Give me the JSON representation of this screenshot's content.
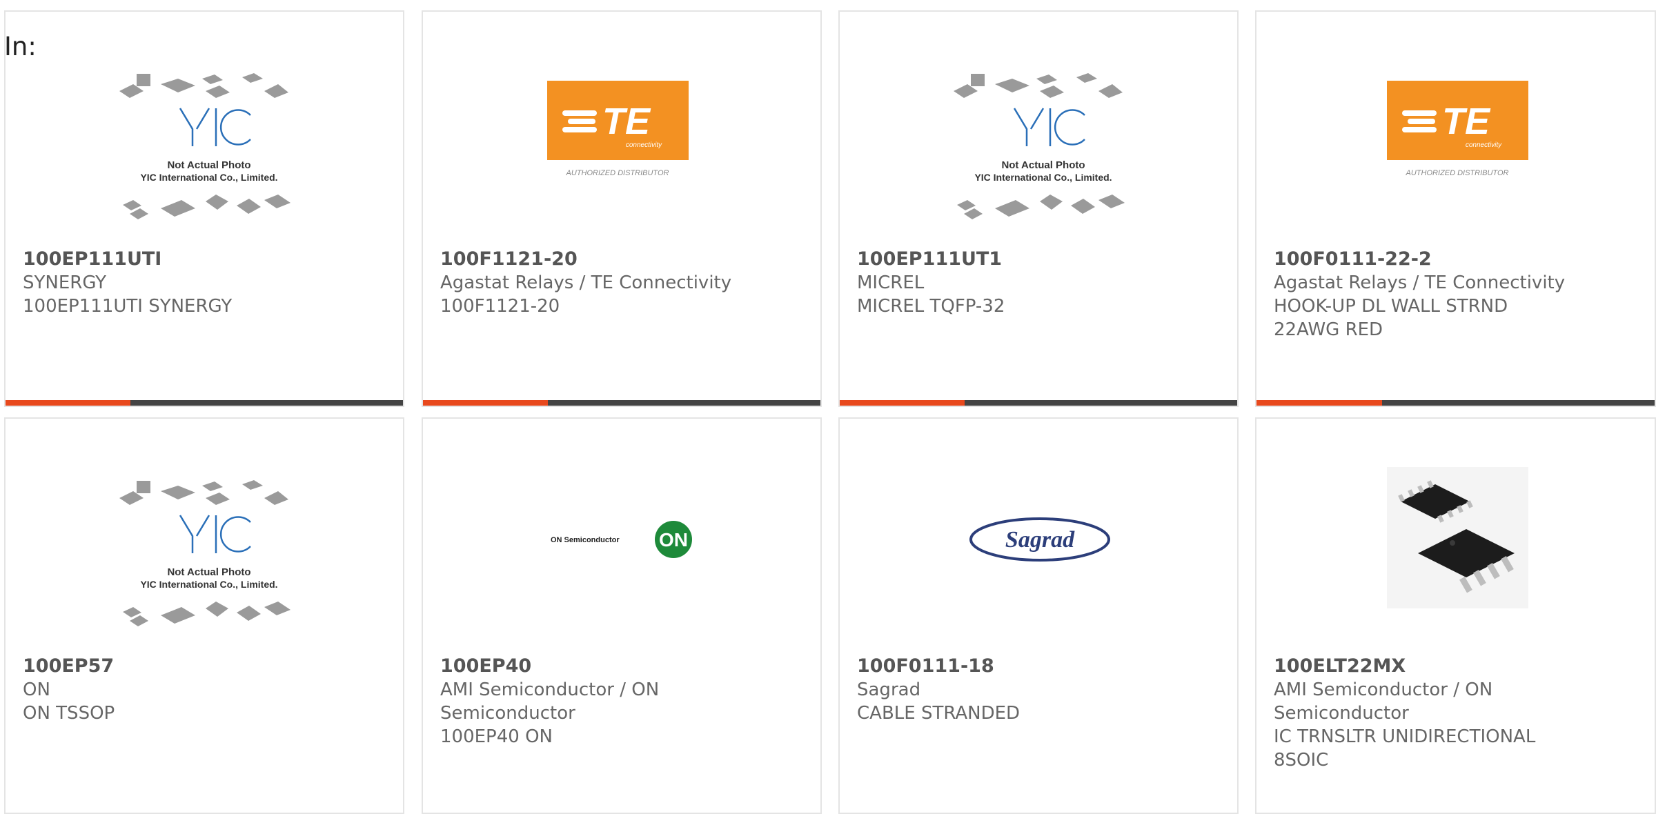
{
  "page": {
    "in_label": "In:"
  },
  "colors": {
    "accent": "#e8491d",
    "bar": "#444444",
    "te_orange": "#f39122",
    "yic_blue": "#2a6fb8",
    "on_green": "#1e8a3a"
  },
  "products": [
    {
      "part": "100EP111UTI",
      "manufacturer": "SYNERGY",
      "desc1": "100EP111UTI SYNERGY",
      "desc2": "",
      "image": "yic-placeholder",
      "image_caption1": "Not Actual Photo",
      "image_caption2": "YIC International Co., Limited.",
      "logo_text": "YIC"
    },
    {
      "part": "100F1121-20",
      "manufacturer": "Agastat Relays / TE Connectivity",
      "desc1": "100F1121-20",
      "desc2": "",
      "image": "te-logo",
      "logo_text": "TE",
      "logo_sub": "connectivity",
      "image_caption1": "AUTHORIZED DISTRIBUTOR"
    },
    {
      "part": "100EP111UT1",
      "manufacturer": "MICREL",
      "desc1": "MICREL TQFP-32",
      "desc2": "",
      "image": "yic-placeholder",
      "image_caption1": "Not Actual Photo",
      "image_caption2": "YIC International Co., Limited.",
      "logo_text": "YIC"
    },
    {
      "part": "100F0111-22-2",
      "manufacturer": "Agastat Relays / TE Connectivity",
      "desc1": "HOOK-UP DL WALL STRND",
      "desc2": "22AWG RED",
      "image": "te-logo",
      "logo_text": "TE",
      "logo_sub": "connectivity",
      "image_caption1": "AUTHORIZED DISTRIBUTOR"
    },
    {
      "part": "100EP57",
      "manufacturer": "ON",
      "desc1": "ON TSSOP",
      "desc2": "",
      "image": "yic-placeholder",
      "image_caption1": "Not Actual Photo",
      "image_caption2": "YIC International Co., Limited.",
      "logo_text": "YIC"
    },
    {
      "part": "100EP40",
      "manufacturer_line1": "AMI Semiconductor / ON",
      "manufacturer_line2": "Semiconductor",
      "desc1": "100EP40 ON",
      "image": "on-logo",
      "logo_text": "ON Semiconductor",
      "logo_badge": "ON"
    },
    {
      "part": "100F0111-18",
      "manufacturer": "Sagrad",
      "desc1": "CABLE STRANDED",
      "desc2": "",
      "image": "sagrad-logo",
      "logo_text": "Sagrad"
    },
    {
      "part": "100ELT22MX",
      "manufacturer_line1": "AMI Semiconductor / ON",
      "manufacturer_line2": "Semiconductor",
      "desc1": "IC TRNSLTR UNIDIRECTIONAL",
      "desc2": "8SOIC",
      "image": "soic-chip"
    }
  ]
}
